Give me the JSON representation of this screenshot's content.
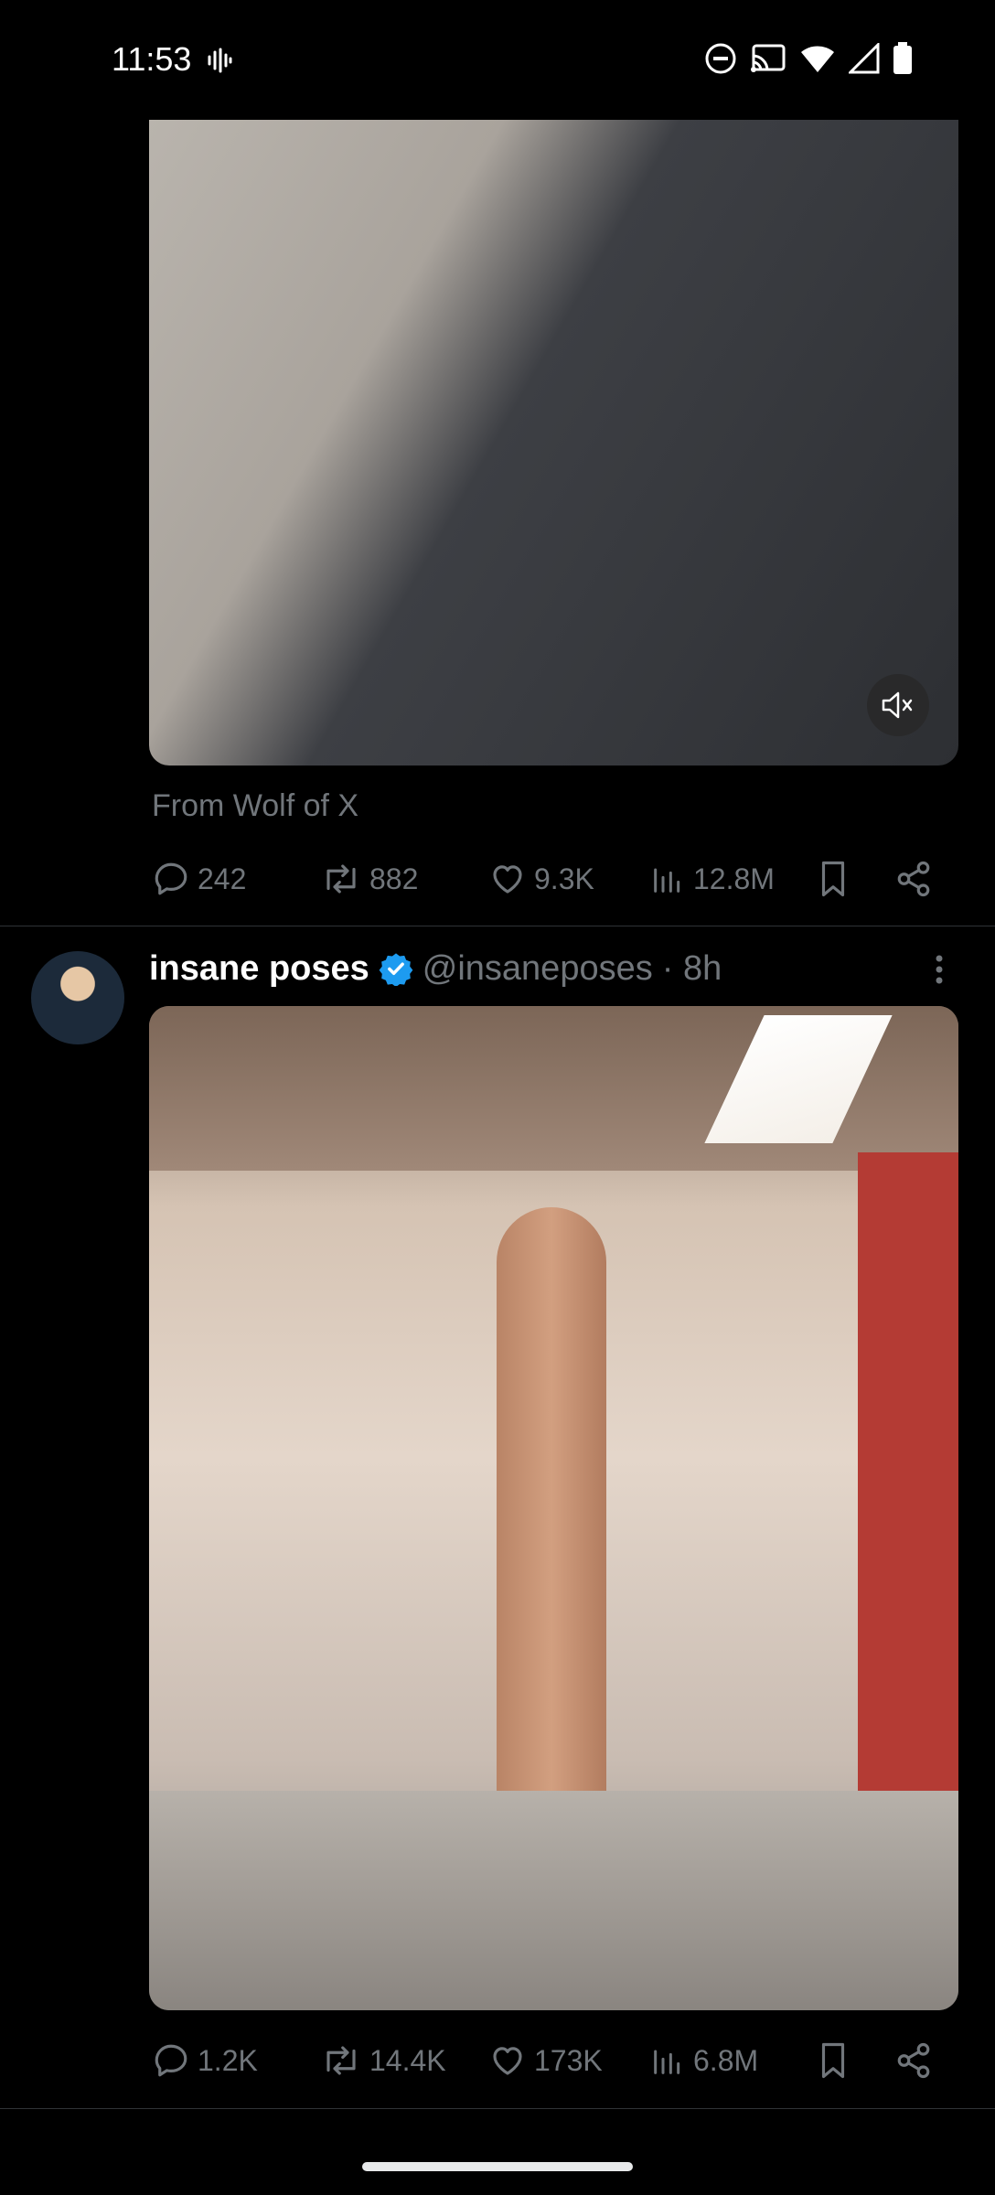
{
  "status_bar": {
    "time": "11:53"
  },
  "post1": {
    "media_label": "video-frame",
    "source_text": "From Wolf of X",
    "replies": "242",
    "reposts": "882",
    "likes": "9.3K",
    "views": "12.8M"
  },
  "post2": {
    "author_name": "insane poses",
    "author_handle": "@insaneposes",
    "time_ago": "· 8h",
    "replies": "1.2K",
    "reposts": "14.4K",
    "likes": "173K",
    "views": "6.8M"
  },
  "colors": {
    "background": "#000000",
    "text_primary": "#e7e9ea",
    "text_secondary": "#71767b",
    "verified_blue": "#1d9bf0",
    "divider": "#2f3336"
  },
  "icons": [
    "reply-icon",
    "repost-icon",
    "like-icon",
    "views-icon",
    "bookmark-icon",
    "share-icon",
    "mute-icon",
    "verified-icon",
    "more-icon"
  ]
}
